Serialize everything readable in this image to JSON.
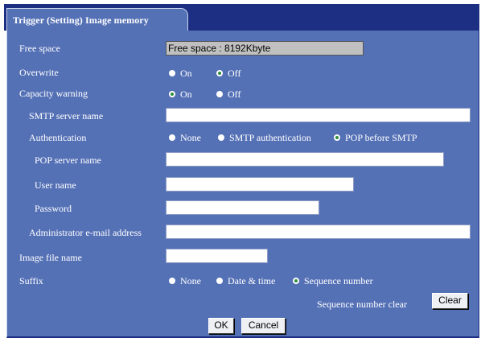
{
  "tab_title": "Trigger (Setting) Image memory",
  "labels": {
    "free_space": "Free space",
    "overwrite": "Overwrite",
    "capacity_warning": "Capacity warning",
    "smtp_server_name": "SMTP server name",
    "authentication": "Authentication",
    "pop_server_name": "POP server name",
    "user_name": "User name",
    "password": "Password",
    "admin_email": "Administrator e-mail address",
    "image_file_name": "Image file name",
    "suffix": "Suffix",
    "sequence_clear": "Sequence number clear"
  },
  "free_space_value": "Free space : 8192Kbyte",
  "overwrite": {
    "on": "On",
    "off": "Off",
    "selected": "off"
  },
  "capacity_warning": {
    "on": "On",
    "off": "Off",
    "selected": "on"
  },
  "authentication": {
    "none": "None",
    "smtp": "SMTP authentication",
    "pop": "POP before SMTP",
    "selected": "pop"
  },
  "suffix": {
    "none": "None",
    "date_time": "Date & time",
    "sequence": "Sequence number",
    "selected": "sequence"
  },
  "fields": {
    "smtp_server_name": "",
    "pop_server_name": "",
    "user_name": "",
    "password": "",
    "admin_email": "",
    "image_file_name": ""
  },
  "buttons": {
    "clear": "Clear",
    "ok": "OK",
    "cancel": "Cancel"
  },
  "colors": {
    "panel": "#5571b6",
    "header": "#1d2f82",
    "radio_selected": "#2f8d3a"
  }
}
